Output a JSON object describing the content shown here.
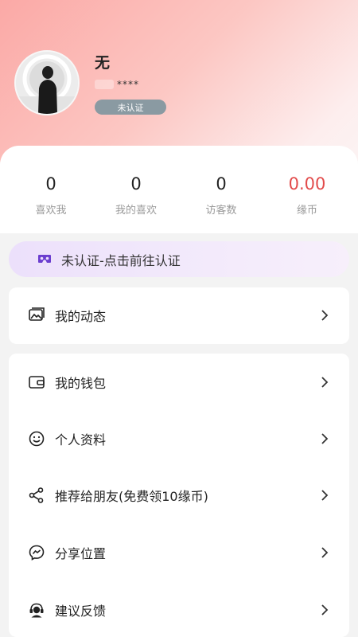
{
  "profile": {
    "username": "无",
    "masked_id": "****",
    "verify_status": "未认证"
  },
  "stats": [
    {
      "value": "0",
      "label": "喜欢我"
    },
    {
      "value": "0",
      "label": "我的喜欢"
    },
    {
      "value": "0",
      "label": "访客数"
    },
    {
      "value": "0.00",
      "label": "缘币"
    }
  ],
  "verify_banner": {
    "text": "未认证-点击前往认证",
    "icon": "vr-goggles-icon"
  },
  "menu_group1": [
    {
      "label": "我的动态",
      "icon": "gallery-icon"
    }
  ],
  "menu_group2": [
    {
      "label": "我的钱包",
      "icon": "wallet-icon"
    },
    {
      "label": "个人资料",
      "icon": "smile-icon"
    },
    {
      "label": "推荐给朋友(免费领10缘币)",
      "icon": "share-icon"
    },
    {
      "label": "分享位置",
      "icon": "messenger-icon"
    },
    {
      "label": "建议反馈",
      "icon": "support-agent-icon"
    }
  ],
  "colors": {
    "accent_money": "#e24b4b",
    "verify_tag_bg": "#8a9aa2",
    "banner_icon": "#6b3ecf"
  }
}
